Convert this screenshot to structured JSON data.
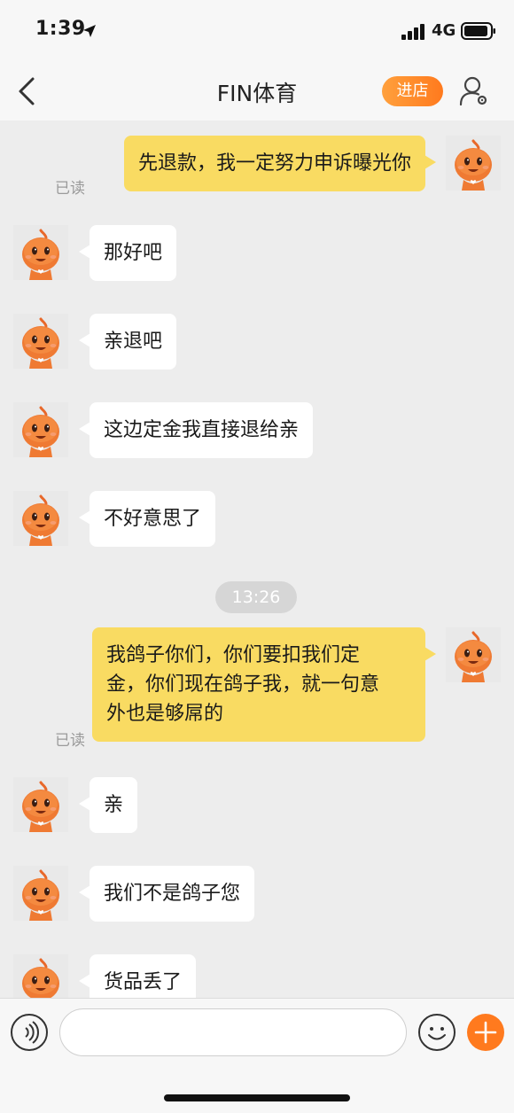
{
  "status_bar": {
    "time": "1:39",
    "network": "4G"
  },
  "nav": {
    "title": "FIN体育",
    "store_button": "进店"
  },
  "messages": [
    {
      "from": "me",
      "text": "先退款，我一定努力申诉曝光你",
      "read": "已读"
    },
    {
      "from": "them",
      "text": "那好吧"
    },
    {
      "from": "them",
      "text": "亲退吧"
    },
    {
      "from": "them",
      "text": "这边定金我直接退给亲"
    },
    {
      "from": "them",
      "text": "不好意思了"
    },
    {
      "from": "me",
      "lines": [
        "我鸽子你们，你们要扣我们定",
        "金，你们现在鸽子我，就一句意",
        "外也是够屌的"
      ],
      "read": "已读"
    },
    {
      "from": "them",
      "text": "亲"
    },
    {
      "from": "them",
      "text": "我们不是鸽子您"
    },
    {
      "from": "them",
      "text": "货品丢了"
    }
  ],
  "timestamp": "13:26",
  "input": {
    "placeholder": ""
  },
  "colors": {
    "my_bubble": "#f9db62",
    "their_bubble": "#ffffff",
    "accent": "#ff7a1e",
    "background": "#ededed"
  },
  "icons": [
    "location-arrow-icon",
    "signal-icon",
    "battery-icon",
    "back-chevron-icon",
    "user-settings-icon",
    "voice-icon",
    "emoji-icon",
    "plus-icon"
  ]
}
